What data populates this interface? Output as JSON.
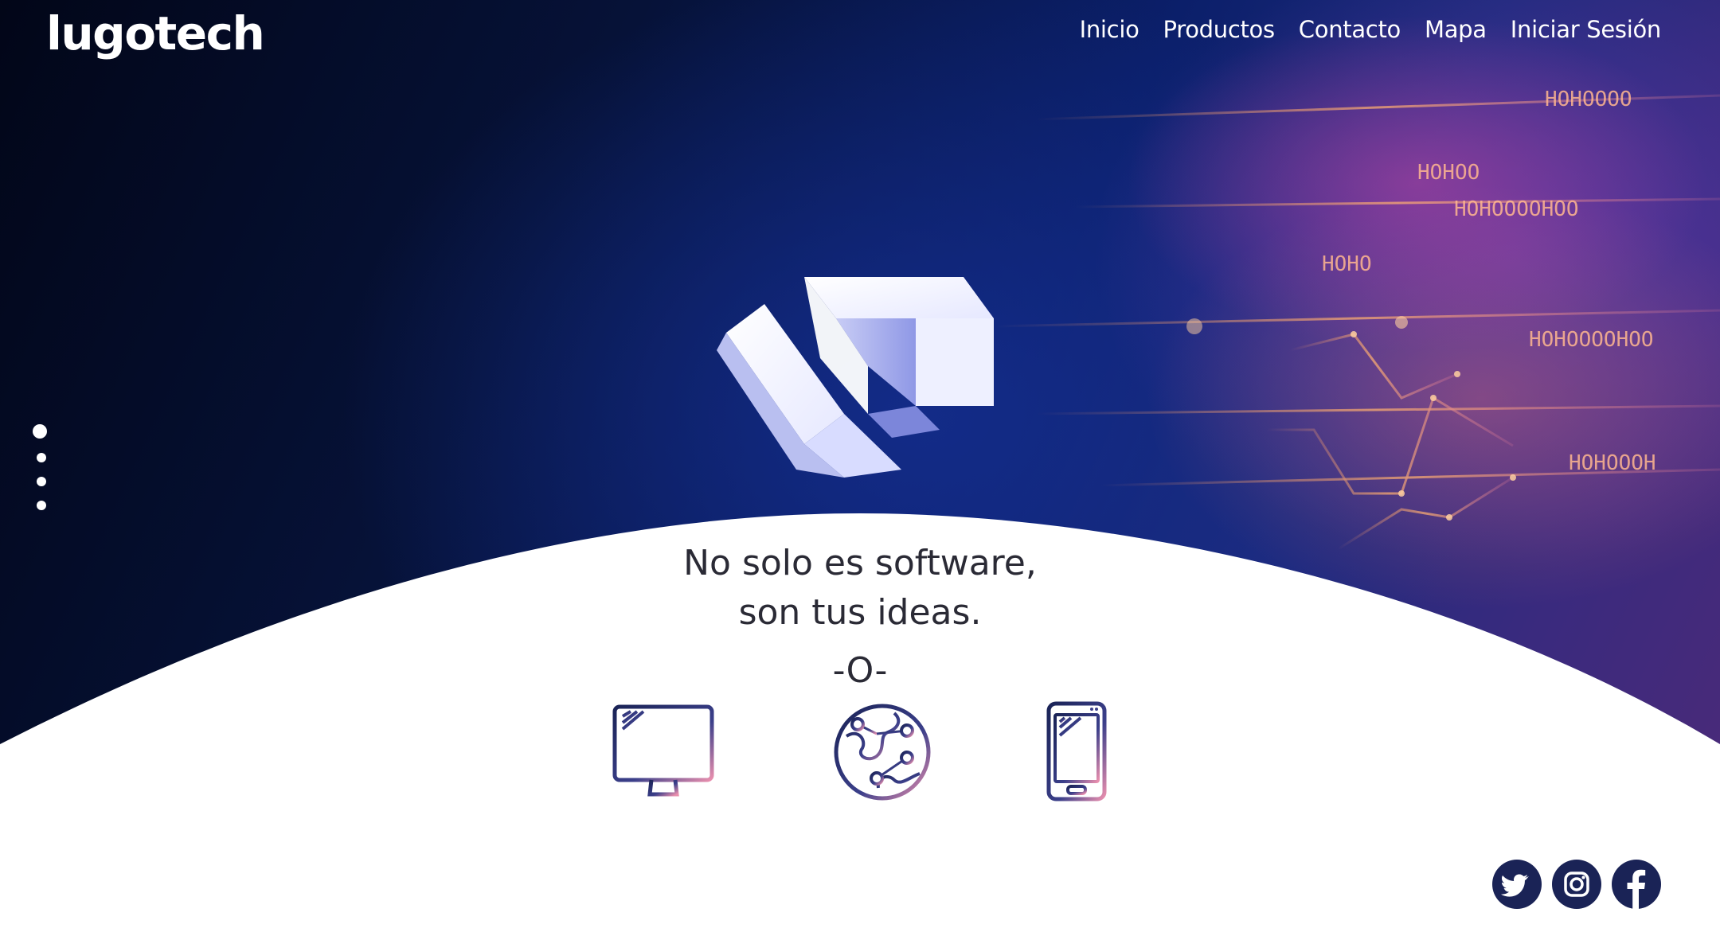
{
  "brand": {
    "name": "lugotech"
  },
  "nav": {
    "items": [
      {
        "label": "Inicio"
      },
      {
        "label": "Productos"
      },
      {
        "label": "Contacto"
      },
      {
        "label": "Mapa"
      },
      {
        "label": "Iniciar Sesión"
      }
    ]
  },
  "hero": {
    "logo_icon": "lt-cube-logo-icon",
    "slider": {
      "count": 4,
      "active_index": 0
    },
    "background_binary_text": [
      "HOHOOOOHOO",
      "HOHOOOOHOO",
      "HOHOOOH",
      "HOHOOOO",
      "HOHOO",
      "HOHO"
    ]
  },
  "headline": {
    "line1": "No solo es software,",
    "line2": "son tus ideas.",
    "separator": "-O-"
  },
  "services": [
    {
      "icon": "desktop-monitor-icon"
    },
    {
      "icon": "globe-network-icon"
    },
    {
      "icon": "smartphone-icon"
    }
  ],
  "social": [
    {
      "icon": "twitter-icon"
    },
    {
      "icon": "instagram-icon"
    },
    {
      "icon": "facebook-icon"
    }
  ],
  "colors": {
    "hero_dark": "#020618",
    "hero_blue": "#0b1f6a",
    "accent_magenta": "#c446a0",
    "accent_orange": "#e86e78",
    "text_dark": "#2a2a35",
    "icon_navy": "#1a2356"
  }
}
